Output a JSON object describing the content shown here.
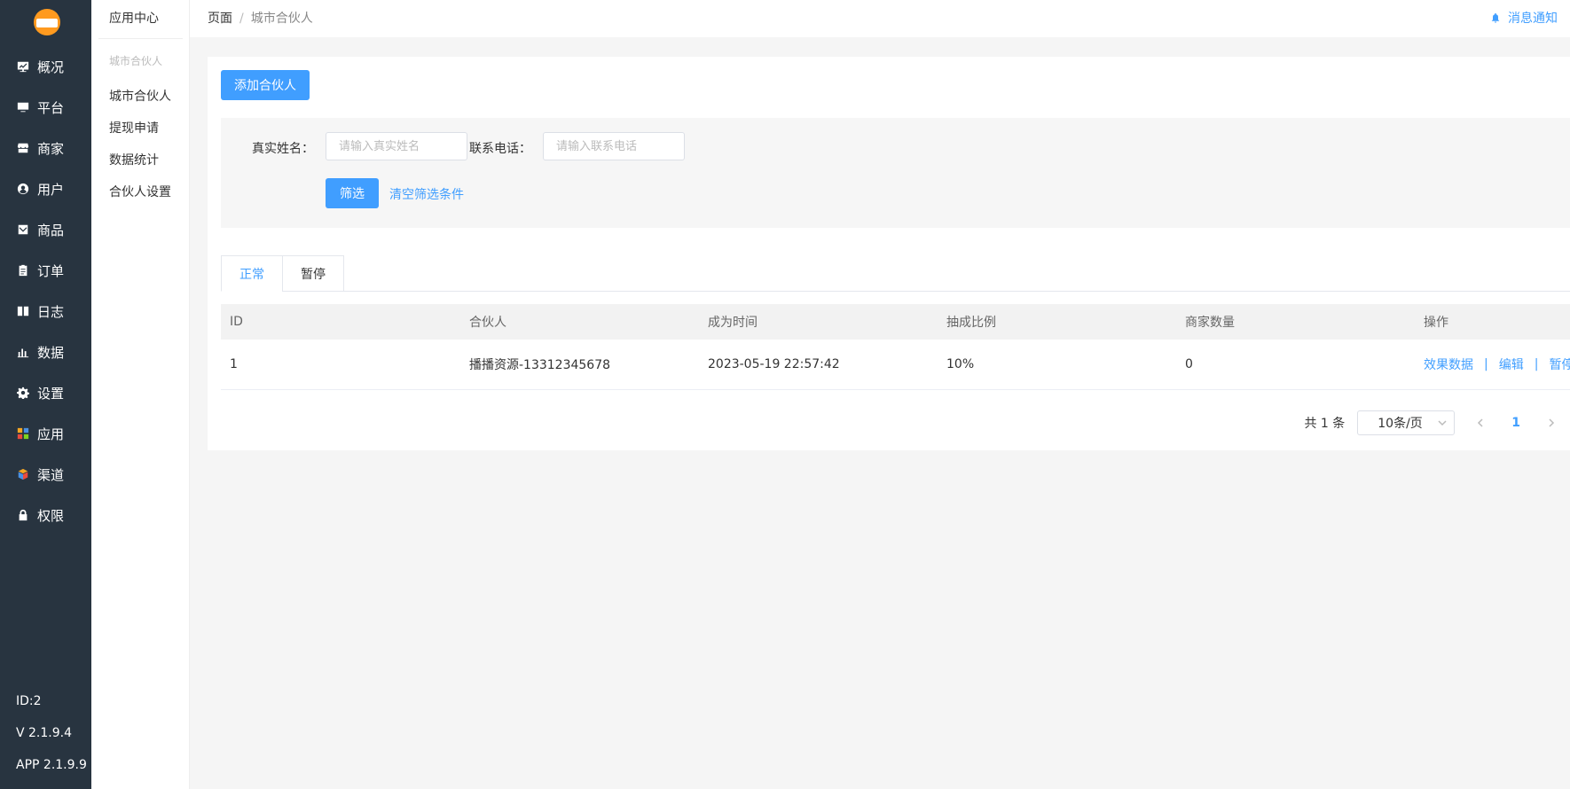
{
  "sidebar": {
    "logo": "logo",
    "items": [
      {
        "label": "概况",
        "icon": "monitor-chart-icon"
      },
      {
        "label": "平台",
        "icon": "desktop-icon"
      },
      {
        "label": "商家",
        "icon": "store-icon"
      },
      {
        "label": "用户",
        "icon": "user-icon"
      },
      {
        "label": "商品",
        "icon": "goods-icon"
      },
      {
        "label": "订单",
        "icon": "clipboard-icon"
      },
      {
        "label": "日志",
        "icon": "book-icon"
      },
      {
        "label": "数据",
        "icon": "bar-chart-icon"
      },
      {
        "label": "设置",
        "icon": "gear-icon"
      },
      {
        "label": "应用",
        "icon": "apps-grid-icon"
      },
      {
        "label": "渠道",
        "icon": "cube-icon"
      },
      {
        "label": "权限",
        "icon": "lock-icon"
      }
    ],
    "footer": {
      "id": "ID:2",
      "version": "V 2.1.9.4",
      "app_version": "APP 2.1.9.9"
    }
  },
  "subnav": {
    "title": "应用中心",
    "group": "城市合伙人",
    "items": [
      "城市合伙人",
      "提现申请",
      "数据统计",
      "合伙人设置"
    ]
  },
  "topbar": {
    "breadcrumb": {
      "root": "页面",
      "separator": "/",
      "current": "城市合伙人"
    },
    "notice": "消息通知"
  },
  "main": {
    "add_button": "添加合伙人",
    "filter": {
      "name_label": "真实姓名：",
      "name_placeholder": "请输入真实姓名",
      "name_value": "",
      "phone_label": "联系电话：",
      "phone_placeholder": "请输入联系电话",
      "phone_value": "",
      "submit": "筛选",
      "clear": "清空筛选条件"
    },
    "tabs": [
      {
        "label": "正常",
        "active": true
      },
      {
        "label": "暂停",
        "active": false
      }
    ],
    "table": {
      "columns": [
        "ID",
        "合伙人",
        "成为时间",
        "抽成比例",
        "商家数量",
        "操作"
      ],
      "rows": [
        {
          "id": "1",
          "partner": "播播资源-13312345678",
          "joined": "2023-05-19 22:57:42",
          "ratio": "10%",
          "merchants": "0",
          "actions": [
            "效果数据",
            "编辑",
            "暂停"
          ],
          "action_sep": "|"
        }
      ]
    },
    "pagination": {
      "total": "共 1 条",
      "page_size": "10条/页",
      "current_page": "1"
    }
  },
  "colors": {
    "sidebar_bg": "#283440",
    "accent": "#409eff",
    "logo": "#ff9a1f"
  }
}
